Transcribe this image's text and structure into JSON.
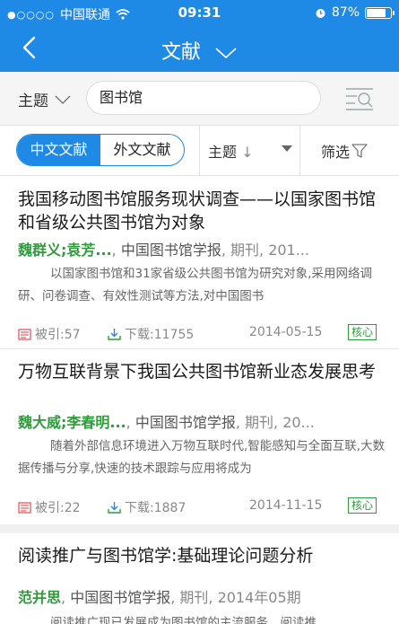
{
  "status": {
    "carrier": "中国联通",
    "time": "09:31",
    "battery": "87%",
    "battery_level": 0.87
  },
  "header": {
    "title": "文献"
  },
  "search": {
    "topic_label": "主题",
    "query": "图书馆"
  },
  "tabs": {
    "chinese": "中文文献",
    "foreign": "外文文献",
    "sort_label": "主题",
    "sort_arrow": "↓",
    "filter_label": "筛选"
  },
  "articles": [
    {
      "title": "我国移动图书馆服务现状调查——以国家图书馆和省级公共图书馆为对象",
      "authors": "魏群义;袁芳...",
      "journal": "中国图书馆学报",
      "type": "期刊",
      "year": "201...",
      "abstract": "以国家图书馆和31家省级公共图书馆为研究对象,采用网络调研、问卷调查、有效性测试等方法,对中国图书",
      "cited": "被引:57",
      "downloads": "下载:11755",
      "date": "2014-05-15",
      "badge": "核心"
    },
    {
      "title": "万物互联背景下我国公共图书馆新业态发展思考",
      "authors": "魏大威;李春明...",
      "journal": "中国图书馆学报",
      "type": "期刊",
      "year": "20...",
      "abstract": "随着外部信息环境进入万物互联时代,智能感知与全面互联,大数据传播与分享,快速的技术跟踪与应用将成为",
      "cited": "被引:22",
      "downloads": "下载:1887",
      "date": "2014-11-15",
      "badge": "核心"
    },
    {
      "title": "阅读推广与图书馆学:基础理论问题分析",
      "authors": "范并思",
      "journal": "中国图书馆学报",
      "type": "期刊",
      "year": "2014年05期",
      "abstract": "阅读推广现已发展成为图书馆的主流服务，阅读推"
    }
  ]
}
